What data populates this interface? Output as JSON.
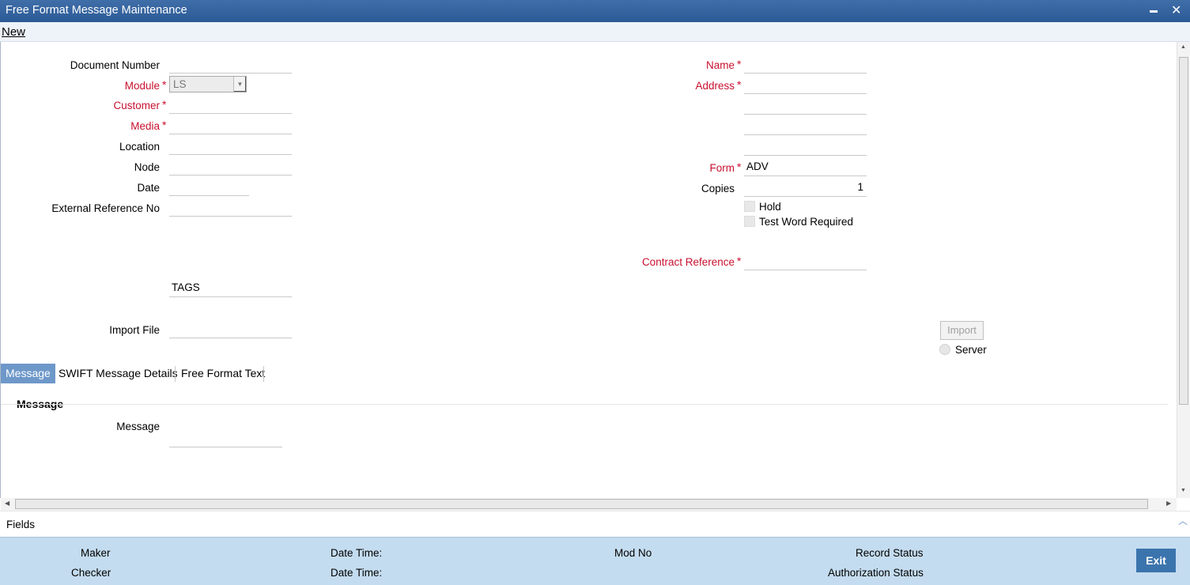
{
  "window": {
    "title": "Free Format Message Maintenance",
    "minimize_glyph": "▬",
    "close_glyph": "✕"
  },
  "menu": {
    "new_label": "New"
  },
  "left_fields": {
    "document_number": {
      "label": "Document Number",
      "value": ""
    },
    "module": {
      "label": "Module",
      "value": "LS"
    },
    "customer": {
      "label": "Customer",
      "value": ""
    },
    "media": {
      "label": "Media",
      "value": ""
    },
    "location": {
      "label": "Location",
      "value": ""
    },
    "node": {
      "label": "Node",
      "value": ""
    },
    "date": {
      "label": "Date",
      "value": ""
    },
    "external_reference": {
      "label": "External Reference No",
      "value": ""
    },
    "tags": {
      "value": "TAGS"
    },
    "import_file": {
      "label": "Import File",
      "value": ""
    }
  },
  "right_fields": {
    "name": {
      "label": "Name",
      "value": ""
    },
    "address": {
      "label": "Address",
      "lines": [
        "",
        "",
        "",
        ""
      ]
    },
    "form": {
      "label": "Form",
      "value": "ADV"
    },
    "copies": {
      "label": "Copies",
      "value": "1"
    },
    "hold": {
      "label": "Hold",
      "checked": false
    },
    "test_word": {
      "label": "Test Word Required",
      "checked": false
    },
    "contract_reference": {
      "label": "Contract Reference",
      "value": ""
    }
  },
  "required_marker": "*",
  "import": {
    "button_label": "Import",
    "server_label": "Server"
  },
  "tabs": [
    {
      "label": "Message",
      "active": true
    },
    {
      "label": "SWIFT Message Details",
      "active": false
    },
    {
      "label": "Free Format Text",
      "active": false
    }
  ],
  "message_section": {
    "title": "Message",
    "field_label": "Message",
    "value": ""
  },
  "fields_label": "Fields",
  "footer": {
    "maker": "Maker",
    "checker": "Checker",
    "date_time_1": "Date Time:",
    "date_time_2": "Date Time:",
    "mod_no": "Mod No",
    "record_status": "Record Status",
    "authorization_status": "Authorization Status",
    "exit_label": "Exit"
  },
  "colors": {
    "title_bar": "#2c5a96",
    "required_label": "#c8102e",
    "active_tab": "#6e98c9",
    "footer_bg": "#c4dcef",
    "exit_button": "#3b74ad"
  }
}
